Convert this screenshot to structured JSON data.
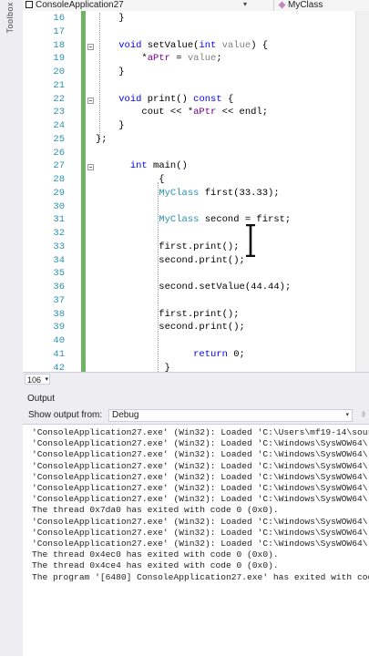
{
  "rail": {
    "label": "Toolbox"
  },
  "navbar": {
    "project": "ConsoleApplication27",
    "class": "MyClass"
  },
  "editor": {
    "lines": [
      {
        "n": "16",
        "tokens": [
          {
            "t": "    }",
            "c": ""
          }
        ]
      },
      {
        "n": "17",
        "tokens": []
      },
      {
        "n": "18",
        "tokens": [
          {
            "t": "    ",
            "c": ""
          },
          {
            "t": "void",
            "c": "kw"
          },
          {
            "t": " setValue(",
            "c": ""
          },
          {
            "t": "int",
            "c": "kw"
          },
          {
            "t": " ",
            "c": ""
          },
          {
            "t": "value",
            "c": "pm"
          },
          {
            "t": ") {",
            "c": ""
          }
        ]
      },
      {
        "n": "19",
        "tokens": [
          {
            "t": "        *",
            "c": ""
          },
          {
            "t": "aPtr",
            "c": "fld"
          },
          {
            "t": " = ",
            "c": ""
          },
          {
            "t": "value",
            "c": "pm"
          },
          {
            "t": ";",
            "c": ""
          }
        ]
      },
      {
        "n": "20",
        "tokens": [
          {
            "t": "    }",
            "c": ""
          }
        ]
      },
      {
        "n": "21",
        "tokens": []
      },
      {
        "n": "22",
        "tokens": [
          {
            "t": "    ",
            "c": ""
          },
          {
            "t": "void",
            "c": "kw"
          },
          {
            "t": " print() ",
            "c": ""
          },
          {
            "t": "const",
            "c": "kw"
          },
          {
            "t": " {",
            "c": ""
          }
        ]
      },
      {
        "n": "23",
        "tokens": [
          {
            "t": "        cout << *",
            "c": ""
          },
          {
            "t": "aPtr",
            "c": "fld"
          },
          {
            "t": " << endl;",
            "c": ""
          }
        ]
      },
      {
        "n": "24",
        "tokens": [
          {
            "t": "    }",
            "c": ""
          }
        ]
      },
      {
        "n": "25",
        "tokens": [
          {
            "t": "};",
            "c": ""
          }
        ]
      },
      {
        "n": "26",
        "tokens": []
      },
      {
        "n": "27",
        "tokens": [
          {
            "t": "      ",
            "c": ""
          },
          {
            "t": "int",
            "c": "kw"
          },
          {
            "t": " main()",
            "c": ""
          }
        ]
      },
      {
        "n": "28",
        "tokens": [
          {
            "t": "           {",
            "c": ""
          }
        ]
      },
      {
        "n": "29",
        "tokens": [
          {
            "t": "           ",
            "c": ""
          },
          {
            "t": "MyClass",
            "c": "ty"
          },
          {
            "t": " first(",
            "c": ""
          },
          {
            "t": "33.33",
            "c": ""
          },
          {
            "t": ");",
            "c": ""
          }
        ]
      },
      {
        "n": "30",
        "tokens": []
      },
      {
        "n": "31",
        "tokens": [
          {
            "t": "           ",
            "c": ""
          },
          {
            "t": "MyClass",
            "c": "ty"
          },
          {
            "t": " second = first;",
            "c": ""
          }
        ]
      },
      {
        "n": "32",
        "tokens": []
      },
      {
        "n": "33",
        "tokens": [
          {
            "t": "           first.print();",
            "c": ""
          }
        ]
      },
      {
        "n": "34",
        "tokens": [
          {
            "t": "           second.print();",
            "c": ""
          }
        ]
      },
      {
        "n": "35",
        "tokens": []
      },
      {
        "n": "36",
        "tokens": [
          {
            "t": "           second.setValue(",
            "c": ""
          },
          {
            "t": "44.44",
            "c": ""
          },
          {
            "t": ");",
            "c": ""
          }
        ]
      },
      {
        "n": "37",
        "tokens": []
      },
      {
        "n": "38",
        "tokens": [
          {
            "t": "           first.print();",
            "c": ""
          }
        ]
      },
      {
        "n": "39",
        "tokens": [
          {
            "t": "           second.print();",
            "c": ""
          }
        ]
      },
      {
        "n": "40",
        "tokens": []
      },
      {
        "n": "41",
        "tokens": [
          {
            "t": "                 ",
            "c": ""
          },
          {
            "t": "return",
            "c": "kw"
          },
          {
            "t": " 0;",
            "c": ""
          }
        ]
      },
      {
        "n": "42",
        "tokens": [
          {
            "t": "            }",
            "c": ""
          }
        ]
      }
    ]
  },
  "zoom": {
    "value": "106 %"
  },
  "output": {
    "title": "Output",
    "show_from_label": "Show output from:",
    "source": "Debug",
    "lines": [
      "'ConsoleApplication27.exe' (Win32): Loaded 'C:\\Users\\mf19-14\\sour",
      "'ConsoleApplication27.exe' (Win32): Loaded 'C:\\Windows\\SysWOW64\\",
      "'ConsoleApplication27.exe' (Win32): Loaded 'C:\\Windows\\SysWOW64\\",
      "'ConsoleApplication27.exe' (Win32): Loaded 'C:\\Windows\\SysWOW64\\",
      "'ConsoleApplication27.exe' (Win32): Loaded 'C:\\Windows\\SysWOW64\\",
      "'ConsoleApplication27.exe' (Win32): Loaded 'C:\\Windows\\SysWOW64\\",
      "'ConsoleApplication27.exe' (Win32): Loaded 'C:\\Windows\\SysWOW64\\",
      "The thread 0x7da0 has exited with code 0 (0x0).",
      "'ConsoleApplication27.exe' (Win32): Loaded 'C:\\Windows\\SysWOW64\\",
      "'ConsoleApplication27.exe' (Win32): Loaded 'C:\\Windows\\SysWOW64\\",
      "'ConsoleApplication27.exe' (Win32): Loaded 'C:\\Windows\\SysWOW64\\",
      "The thread 0x4ec0 has exited with code 0 (0x0).",
      "The thread 0x4ce4 has exited with code 0 (0x0).",
      "The program '[6480] ConsoleApplication27.exe' has exited with cod"
    ]
  },
  "colors": {
    "keyword": "#0000ff",
    "type": "#2b91af",
    "param": "#808080",
    "field": "#6f008a",
    "line_number": "#2b91af",
    "change_bar": "#57a64a"
  }
}
